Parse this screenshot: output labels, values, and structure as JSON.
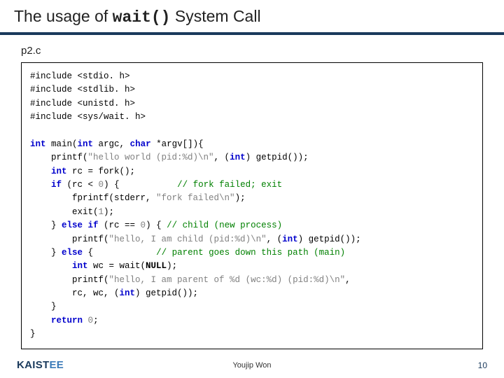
{
  "title_prefix": "The usage of ",
  "title_code": "wait()",
  "title_suffix": " System Call",
  "filename": "p2.c",
  "code": {
    "l1": "#include <stdio. h>",
    "l2": "#include <stdlib. h>",
    "l3": "#include <unistd. h>",
    "l4": "#include <sys/wait. h>",
    "l5a": "int",
    "l5b": " main(",
    "l5c": "int",
    "l5d": " argc, ",
    "l5e": "char",
    "l5f": " *argv[]){",
    "l6a": "    printf(",
    "l6b": "\"hello world (pid:%d)\\n\"",
    "l6c": ", (",
    "l6d": "int",
    "l6e": ") getpid());",
    "l7a": "    ",
    "l7b": "int",
    "l7c": " rc = fork();",
    "l8a": "    ",
    "l8b": "if",
    "l8c": " (rc < ",
    "l8d": "0",
    "l8e": ") {           ",
    "l8f": "// fork failed; exit",
    "l9a": "        fprintf(stderr, ",
    "l9b": "\"fork failed\\n\"",
    "l9c": ");",
    "l10a": "        exit(",
    "l10b": "1",
    "l10c": ");",
    "l11a": "    } ",
    "l11b": "else if",
    "l11c": " (rc == ",
    "l11d": "0",
    "l11e": ") { ",
    "l11f": "// child (new process)",
    "l12a": "        printf(",
    "l12b": "\"hello, I am child (pid:%d)\\n\"",
    "l12c": ", (",
    "l12d": "int",
    "l12e": ") getpid());",
    "l13a": "    } ",
    "l13b": "else",
    "l13c": " {            ",
    "l13f": "// parent goes down this path (main)",
    "l14a": "        ",
    "l14b": "int",
    "l14c": " wc = wait(",
    "l14d": "NULL",
    "l14e": ");",
    "l15a": "        printf(",
    "l15b": "\"hello, I am parent of %d (wc:%d) (pid:%d)\\n\"",
    "l15c": ",",
    "l16a": "        rc, wc, (",
    "l16b": "int",
    "l16c": ") getpid());",
    "l17": "    }",
    "l18a": "    ",
    "l18b": "return",
    "l18c": " ",
    "l18d": "0",
    "l18e": ";",
    "l19": "}"
  },
  "footer": {
    "logo_main": "KAIST",
    "logo_suffix": "EE",
    "author": "Youjip Won",
    "page": "10"
  }
}
